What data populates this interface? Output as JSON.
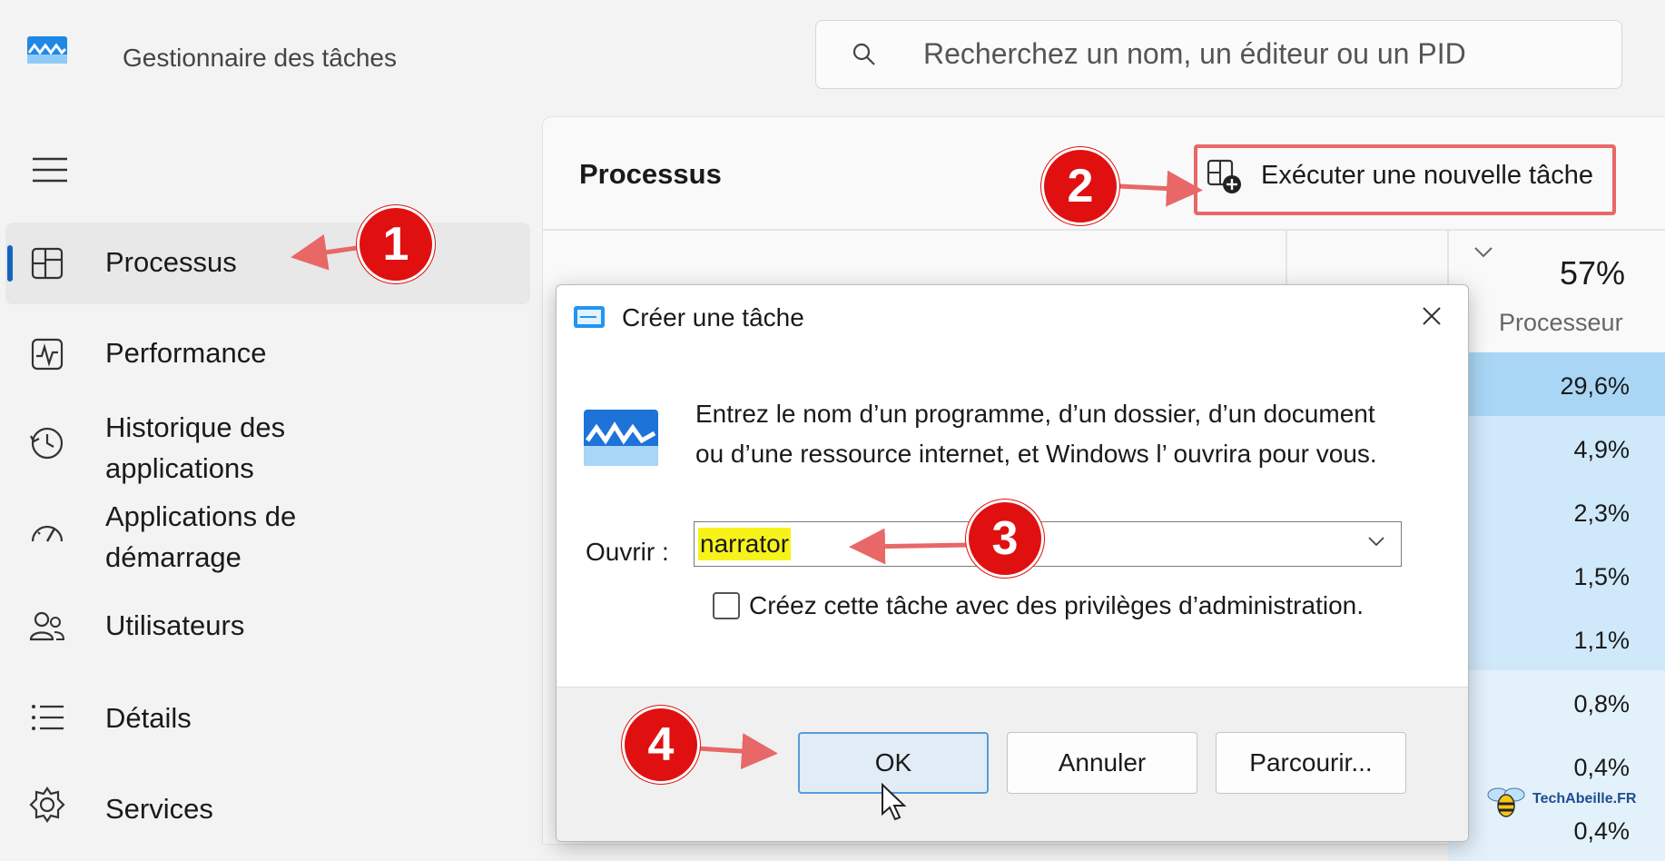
{
  "app": {
    "title": "Gestionnaire des tâches"
  },
  "search": {
    "placeholder": "Recherchez un nom, un éditeur ou un PID"
  },
  "sidebar": {
    "items": [
      {
        "label": "Processus",
        "icon": "processes-icon",
        "active": true
      },
      {
        "label": "Performance",
        "icon": "performance-icon"
      },
      {
        "label": "Historique des\napplications",
        "icon": "app-history-icon"
      },
      {
        "label": "Applications de\ndémarrage",
        "icon": "startup-apps-icon"
      },
      {
        "label": "Utilisateurs",
        "icon": "users-icon"
      },
      {
        "label": "Détails",
        "icon": "details-icon"
      },
      {
        "label": "Services",
        "icon": "services-icon"
      }
    ]
  },
  "main": {
    "title": "Processus",
    "run_task_label": "Exécuter une nouvelle tâche",
    "cpu_header": {
      "percent": "57%",
      "label": "Processeur"
    },
    "cpu_values": [
      "29,6%",
      "4,9%",
      "2,3%",
      "1,5%",
      "1,1%",
      "0,8%",
      "0,4%",
      "0,4%"
    ]
  },
  "dialog": {
    "title": "Créer une tâche",
    "description": "Entrez le nom d’un programme, d’un dossier, d’un document ou d’une ressource internet, et Windows l’ ouvrira pour vous.",
    "open_label": "Ouvrir :",
    "open_value": "narrator",
    "admin_checkbox_label": "Créez cette tâche avec des privilèges d’administration.",
    "admin_checked": false,
    "buttons": {
      "ok": "OK",
      "cancel": "Annuler",
      "browse": "Parcourir..."
    }
  },
  "annotations": {
    "step1": "1",
    "step2": "2",
    "step3": "3",
    "step4": "4"
  },
  "watermark": {
    "text": "TechAbeille.FR"
  },
  "colors": {
    "accent": "#1565c0",
    "annotation": "#e01010",
    "highlight": "#f7f31a",
    "cpu_heat": "#a9d6f5"
  }
}
